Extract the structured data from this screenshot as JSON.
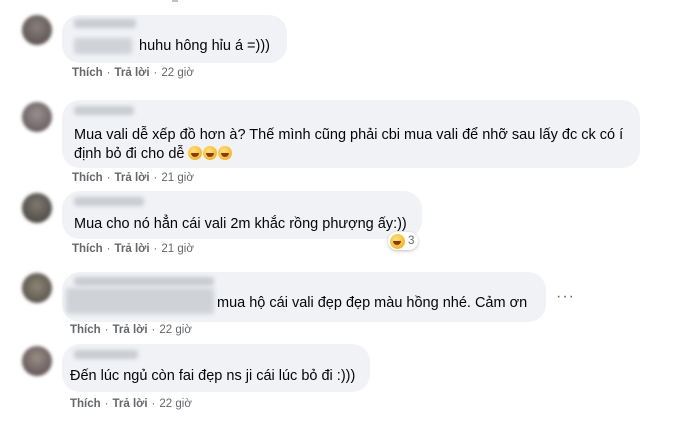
{
  "actions": {
    "like": "Thích",
    "reply": "Trả lời"
  },
  "comments": [
    {
      "text": "huhu hông hỉu á =)))",
      "time": "22 giờ"
    },
    {
      "text_line1": "Mua vali dễ xếp đồ hơn à? Thế mình cũng phải cbi mua vali để nhỡ sau lấy đc ck có í",
      "text_line2": "định bỏ đi cho dễ",
      "time": "21 giờ"
    },
    {
      "text": "Mua cho nó hẳn cái vali 2m khắc rồng phượng ấy:))",
      "time": "21 giờ",
      "reaction_count": "3"
    },
    {
      "text": "mua hộ cái vali đẹp đẹp màu hồng nhé. Cảm ơn",
      "time": "22 giờ",
      "more": "···"
    },
    {
      "text": "Đến lúc ngủ còn fai đẹp ns ji cái lúc bỏ đi :)))",
      "time": "22 giờ"
    }
  ],
  "colors": {
    "bubble": "#f0f2f5",
    "meta": "#65676b",
    "text": "#050505"
  }
}
